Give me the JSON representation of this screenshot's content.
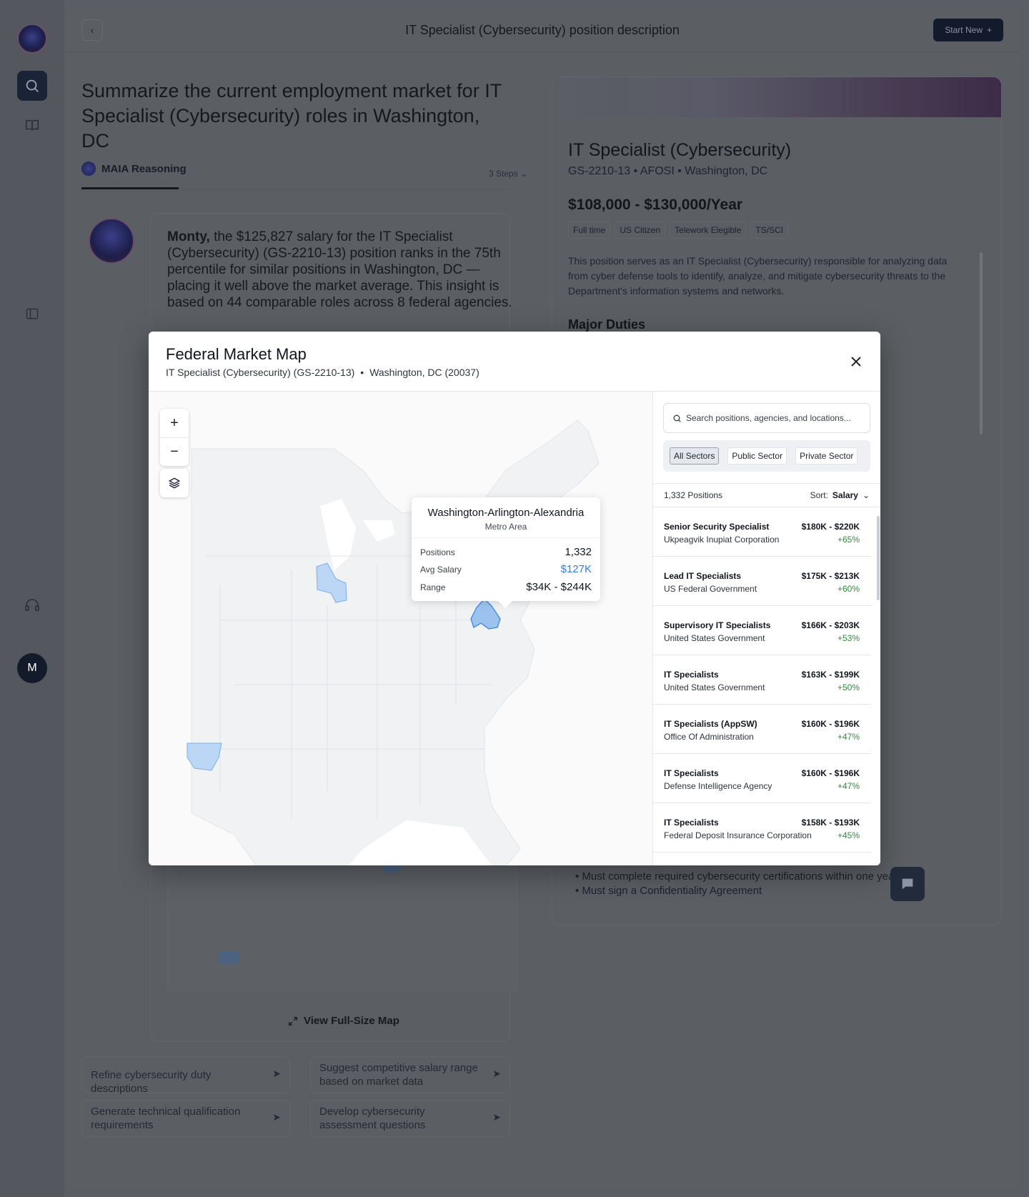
{
  "app": {
    "title": "IT Specialist (Cybersecurity) position description",
    "start_new_label": "Start New",
    "start_new_icon": "+",
    "back_icon": "‹"
  },
  "rail": {
    "avatar_initial": "M"
  },
  "conversation": {
    "question": "Summarize the current employment market for IT Specialist (Cybersecurity) roles in Washington, DC",
    "reasoning_label": "MAIA Reasoning",
    "steps_label": "3 Steps",
    "answer_name": "Monty,",
    "answer_body": " the $125,827 salary for the IT Specialist (Cybersecurity) (GS-2210-13) position ranks in the 75th percentile for similar positions in Washington, DC — placing it well above the market average. This insight is based on 44 comparable roles across 8 federal agencies.",
    "view_map_label": "View Full-Size Map",
    "suggestions": [
      "Refine cybersecurity duty descriptions",
      "Suggest competitive salary range based on market data",
      "Generate technical qualification requirements",
      "Develop cybersecurity assessment questions"
    ]
  },
  "position": {
    "title": "IT Specialist (Cybersecurity)",
    "subtitle": "GS-2210-13 • AFOSI • Washington, DC",
    "salary": "$108,000 - $130,000/Year",
    "chips": [
      "Full time",
      "US Citizen",
      "Telework Elegible",
      "TS/SCI"
    ],
    "description": "This position serves as an IT Specialist (Cybersecurity) responsible for analyzing data from cyber defense tools to identify, analyze, and mitigate cybersecurity threats to the Department's information systems and networks.",
    "major_duties_label": "Major Duties",
    "requirements_visible": [
      "Must complete required cybersecurity certifications within one year",
      "Must sign a Confidentiality Agreement"
    ]
  },
  "modal": {
    "title": "Federal Market Map",
    "position": "IT Specialist (Cybersecurity) (GS-2210-13)",
    "separator": "•",
    "location": "Washington, DC (20037)",
    "close_icon": "close-icon",
    "map": {
      "zoom_in": "+",
      "zoom_out": "−",
      "tooltip": {
        "title": "Washington-Arlington-Alexandria",
        "subtitle": "Metro Area",
        "positions_label": "Positions",
        "positions_value": "1,332",
        "avg_label": "Avg Salary",
        "avg_value": "$127K",
        "range_label": "Range",
        "range_value": "$34K - $244K"
      }
    },
    "list": {
      "search_placeholder": "Search positions, agencies, and locations...",
      "sectors": [
        "All Sectors",
        "Public Sector",
        "Private Sector"
      ],
      "active_sector": "All Sectors",
      "count_label": "1,332 Positions",
      "sort_label": "Sort:",
      "sort_value": "Salary",
      "rows": [
        {
          "title": "Senior Security Specialist",
          "org": "Ukpeagvik Inupiat Corporation",
          "range": "$180K - $220K",
          "pct": "+65%"
        },
        {
          "title": "Lead IT Specialists",
          "org": "US Federal Government",
          "range": "$175K - $213K",
          "pct": "+60%"
        },
        {
          "title": "Supervisory IT Specialists",
          "org": "United States Government",
          "range": "$166K - $203K",
          "pct": "+53%"
        },
        {
          "title": "IT Specialists",
          "org": "United States Government",
          "range": "$163K - $199K",
          "pct": "+50%"
        },
        {
          "title": "IT Specialists (AppSW)",
          "org": "Office Of Administration",
          "range": "$160K - $196K",
          "pct": "+47%"
        },
        {
          "title": "IT Specialists",
          "org": "Defense Intelligence Agency",
          "range": "$160K - $196K",
          "pct": "+47%"
        },
        {
          "title": "IT Specialists",
          "org": "Federal Deposit Insurance Corporation",
          "range": "$158K - $193K",
          "pct": "+45%"
        }
      ]
    }
  },
  "colors": {
    "accent_blue": "#2f7de1",
    "positive_green": "#2f8a3e",
    "navy": "#131a2c"
  }
}
